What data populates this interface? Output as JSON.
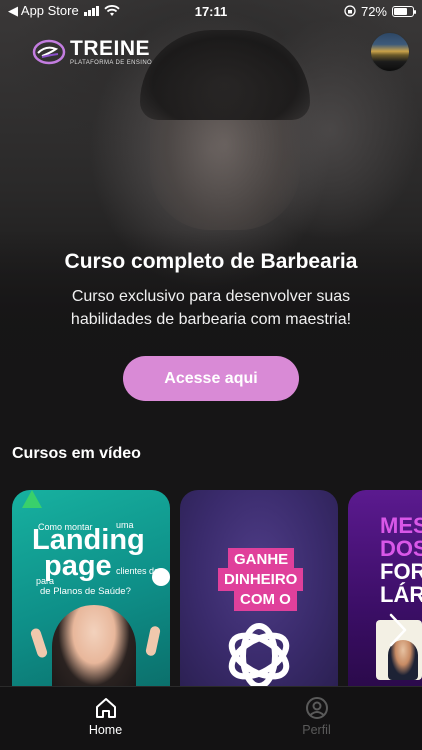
{
  "status_bar": {
    "back_label": "◀ App Store",
    "time": "17:11",
    "battery_percent": "72%",
    "battery_level": 0.72
  },
  "header": {
    "logo_title": "TREINE",
    "logo_subtitle": "PLATAFORMA DE ENSINO",
    "avatar_icon": "profile-photo"
  },
  "hero": {
    "title": "Curso completo de Barbearia",
    "description": "Curso exclusivo para desenvolver suas habilidades de barbearia com maestria!",
    "cta_label": "Acesse aqui"
  },
  "sections": {
    "video_courses_title": "Cursos em vídeo"
  },
  "courses": [
    {
      "small_top": "Como montar",
      "small_top_right": "uma",
      "big_lines": [
        "Landing",
        "page"
      ],
      "small_left": "para",
      "small_right": "clientes de",
      "subtitle": "de Planos de Saúde?"
    },
    {
      "lines": [
        "GANHE",
        "DINHEIRO",
        "COM O"
      ],
      "logo_icon": "openai-logo-icon"
    },
    {
      "lines": [
        "MES",
        "DOS",
        "FOR",
        "LÁR"
      ]
    }
  ],
  "carousel": {
    "next_icon": "chevron-right-icon"
  },
  "tabbar": {
    "tabs": [
      {
        "label": "Home",
        "icon": "home-icon",
        "active": true
      },
      {
        "label": "Perfil",
        "icon": "user-circle-icon",
        "active": false
      }
    ]
  },
  "colors": {
    "accent": "#d98ad6",
    "background": "#161516",
    "card_teal": "#17b1a0",
    "card_purple": "#3a2b6c",
    "card_violet": "#5b1a8f",
    "tab_inactive": "#5a5a5a"
  }
}
